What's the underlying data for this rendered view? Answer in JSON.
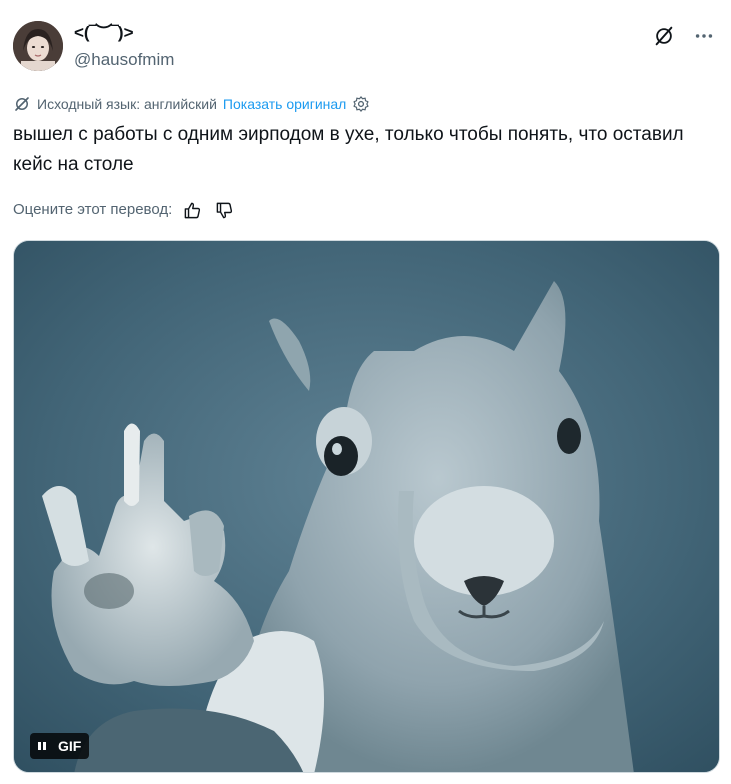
{
  "author": {
    "display_name": "<(‾︶‾)>",
    "handle": "@hausofmim"
  },
  "translation": {
    "source_label": "Исходный язык: английский",
    "show_original": "Показать оригинал"
  },
  "tweet": {
    "text": "вышел с работы с одним эирподом в ухе, только чтобы понять, что оставил кейс на столе"
  },
  "rating": {
    "prompt": "Оцените этот перевод:"
  },
  "media": {
    "badge_label": "GIF",
    "content": "squirrel-gif"
  },
  "icons": {
    "grok": "grok-icon",
    "more": "more-icon",
    "translate": "translate-icon",
    "settings": "gear-icon",
    "thumbs_up": "thumbs-up-icon",
    "thumbs_down": "thumbs-down-icon",
    "pause": "pause-icon"
  },
  "colors": {
    "text": "#0f1419",
    "secondary": "#536471",
    "link": "#1d9bf0"
  }
}
